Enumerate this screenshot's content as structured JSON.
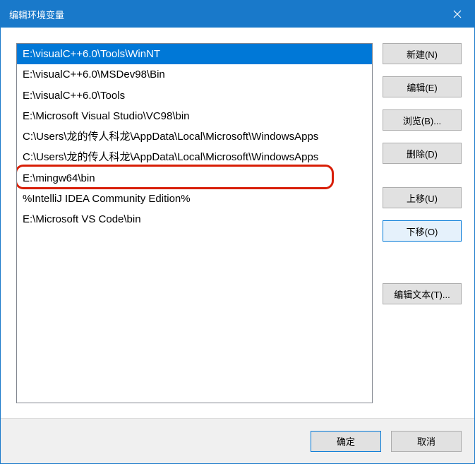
{
  "window": {
    "title": "编辑环境变量"
  },
  "list": {
    "items": [
      "E:\\visualC++6.0\\Tools\\WinNT",
      "E:\\visualC++6.0\\MSDev98\\Bin",
      "E:\\visualC++6.0\\Tools",
      "E:\\Microsoft Visual Studio\\VC98\\bin",
      "C:\\Users\\龙的传人科龙\\AppData\\Local\\Microsoft\\WindowsApps",
      "C:\\Users\\龙的传人科龙\\AppData\\Local\\Microsoft\\WindowsApps",
      "E:\\mingw64\\bin",
      "%IntelliJ IDEA Community Edition%",
      "E:\\Microsoft VS Code\\bin"
    ],
    "selected_index": 0,
    "annotated_index": 6
  },
  "buttons": {
    "new": "新建(N)",
    "edit": "编辑(E)",
    "browse": "浏览(B)...",
    "delete": "删除(D)",
    "move_up": "上移(U)",
    "move_down": "下移(O)",
    "edit_text": "编辑文本(T)..."
  },
  "footer": {
    "ok": "确定",
    "cancel": "取消"
  }
}
